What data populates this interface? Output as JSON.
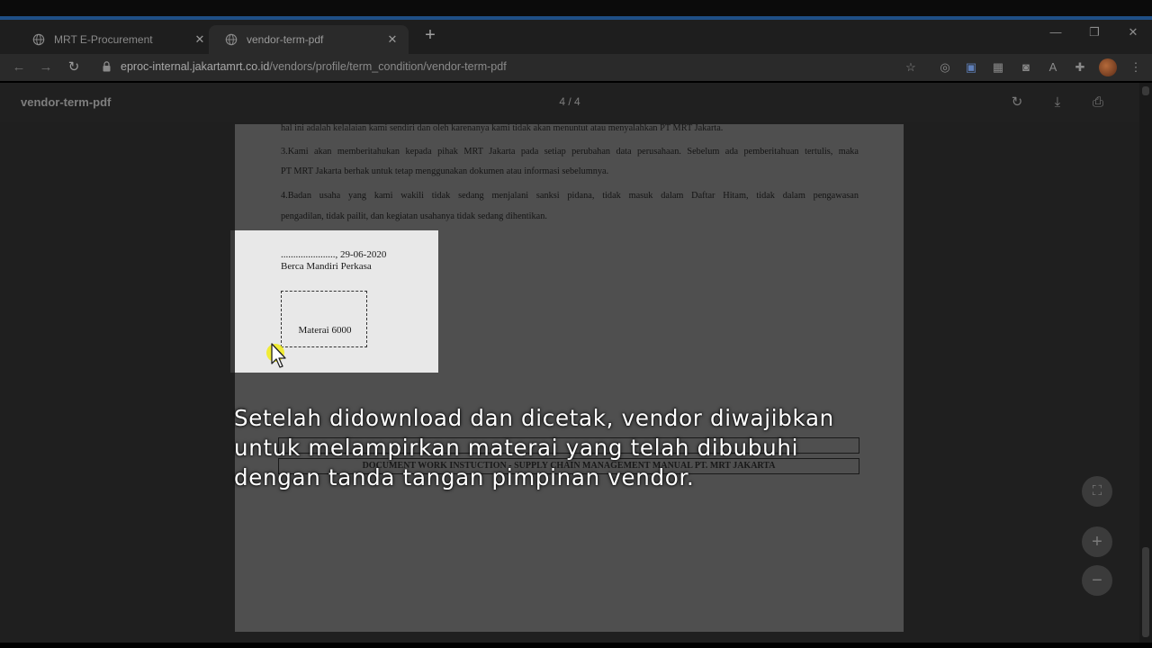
{
  "browser": {
    "tabs": [
      {
        "label": "MRT E-Procurement",
        "close": "✕",
        "active": false
      },
      {
        "label": "vendor-term-pdf",
        "close": "✕",
        "active": true
      }
    ],
    "new_tab": "+",
    "url_host": "eproc-internal.jakartamrt.co.id",
    "url_path": "/vendors/profile/term_condition/vendor-term-pdf",
    "window_controls": {
      "minimize": "—",
      "maximize": "❐",
      "close": "✕"
    }
  },
  "pdf": {
    "title": "vendor-term-pdf",
    "page_indicator": "4 / 4",
    "lines": [
      "hal ini adalah kelalaian kami sendiri dan oleh karenanya kami tidak akan menuntut atau menyalahkan PT MRT Jakarta.",
      "3.Kami akan memberitahukan kepada pihak MRT Jakarta pada setiap perubahan data perusahaan. Sebelum ada pemberitahuan tertulis, maka",
      "PT MRT Jakarta berhak untuk tetap menggunakan dokumen atau informasi sebelumnya.",
      "4.Badan usaha yang kami wakili tidak sedang menjalani sanksi pidana, tidak masuk dalam Daftar Hitam, tidak dalam pengawasan",
      "pengadilan, tidak pailit, dan kegiatan usahanya tidak sedang dihentikan."
    ],
    "footer_title": "DOCUMENT WORK INSTUCTION - SUPPLY CHAIN MANAGEMENT MANUAL PT. MRT JAKARTA"
  },
  "zoom_popup": {
    "date_line": "......................, 29-06-2020",
    "company": "Berca Mandiri Perkasa",
    "stamp_label": "Materai 6000"
  },
  "subtitle": {
    "lines": [
      "Setelah didownload dan dicetak, vendor diwajibkan",
      "untuk melampirkan materai yang telah dibubuhi",
      "dengan tanda tangan pimpinan vendor."
    ]
  },
  "controls": {
    "fit": "⛶",
    "zoom_in": "+",
    "zoom_out": "−"
  }
}
